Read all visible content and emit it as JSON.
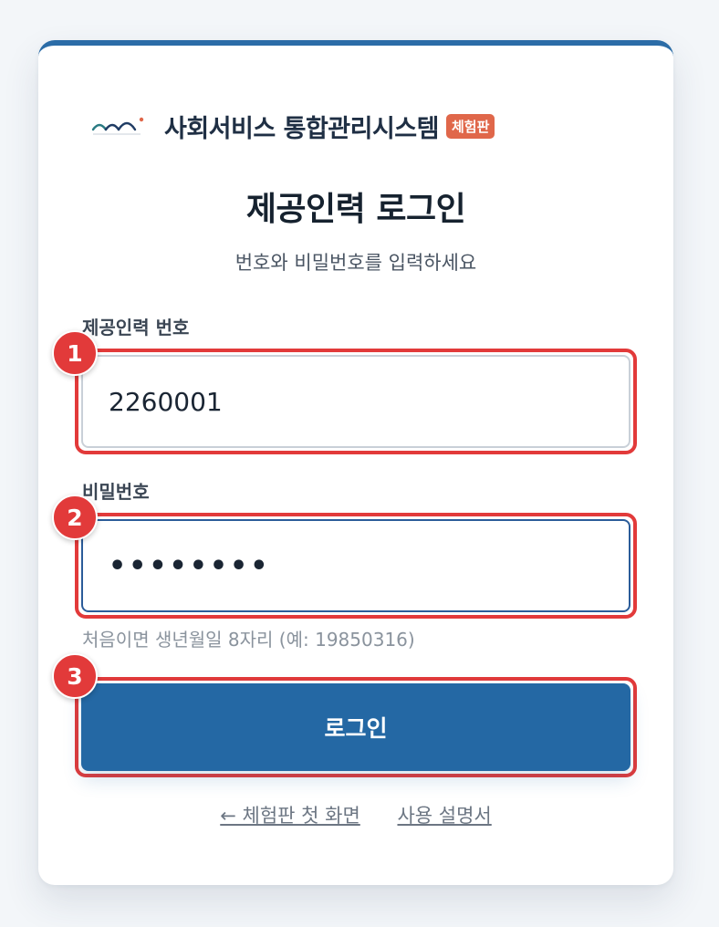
{
  "brand": {
    "name": "사회서비스 통합관리시스템",
    "badge": "체험판",
    "logo_icon": "hills-logo-icon",
    "colors": {
      "teal": "#2a7b83",
      "navy": "#1f3c64",
      "dot": "#e0674a"
    }
  },
  "title": "제공인력 로그인",
  "subtitle": "번호와 비밀번호를 입력하세요",
  "form": {
    "id_label": "제공인력 번호",
    "id_value": "2260001",
    "password_label": "비밀번호",
    "password_value": "••••••••",
    "password_hint": "처음이면 생년월일 8자리 (예: 19850316)",
    "submit_label": "로그인"
  },
  "steps": [
    "1",
    "2",
    "3"
  ],
  "links": {
    "back_label": "← 체험판 첫 화면",
    "manual_label": "사용 설명서"
  },
  "colors": {
    "accent": "#2468a4",
    "highlight": "#e23a3a",
    "badge": "#e0674a"
  }
}
